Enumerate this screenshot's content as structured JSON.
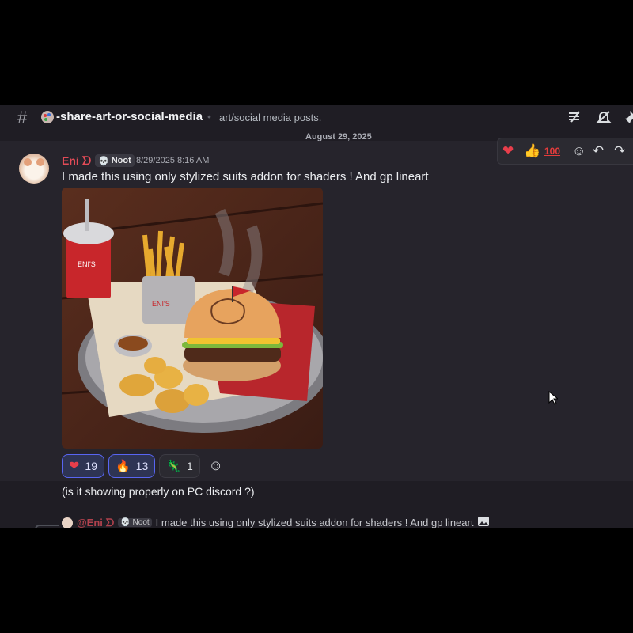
{
  "channel": {
    "name": "-share-art-or-social-media",
    "topic": "art/social media posts."
  },
  "date_divider": "August 29, 2025",
  "message": {
    "username": "Eni",
    "username_glyph": "ᗤ",
    "tag": "Noot",
    "timestamp": "8/29/2025 8:16 AM",
    "text": "I made this using only stylized suits addon for shaders ! And gp lineart",
    "image_alt": "Stylized 3D render of a burger, fries, drink, sauce and nuggets on a tray",
    "reactions": [
      {
        "emoji": "heart",
        "count": "19"
      },
      {
        "emoji": "fire",
        "count": "13"
      },
      {
        "emoji": "lizard",
        "count": "1"
      }
    ]
  },
  "followup_text": "(is it showing properly on PC discord ?)",
  "reply_preview": {
    "username": "@Eni",
    "tag": "Noot",
    "text": "I made this using only stylized suits addon for shaders ! And gp lineart"
  },
  "colors": {
    "background": "#1f1d24",
    "hover": "#26242c",
    "username": "#e34b57",
    "accent": "#5865f2"
  },
  "icons": [
    "hash-icon",
    "threads-icon",
    "mute-icon",
    "pin-icon",
    "heart-icon",
    "thumbs-up-icon",
    "hundred-icon",
    "add-reaction-icon",
    "reply-icon",
    "forward-icon"
  ]
}
